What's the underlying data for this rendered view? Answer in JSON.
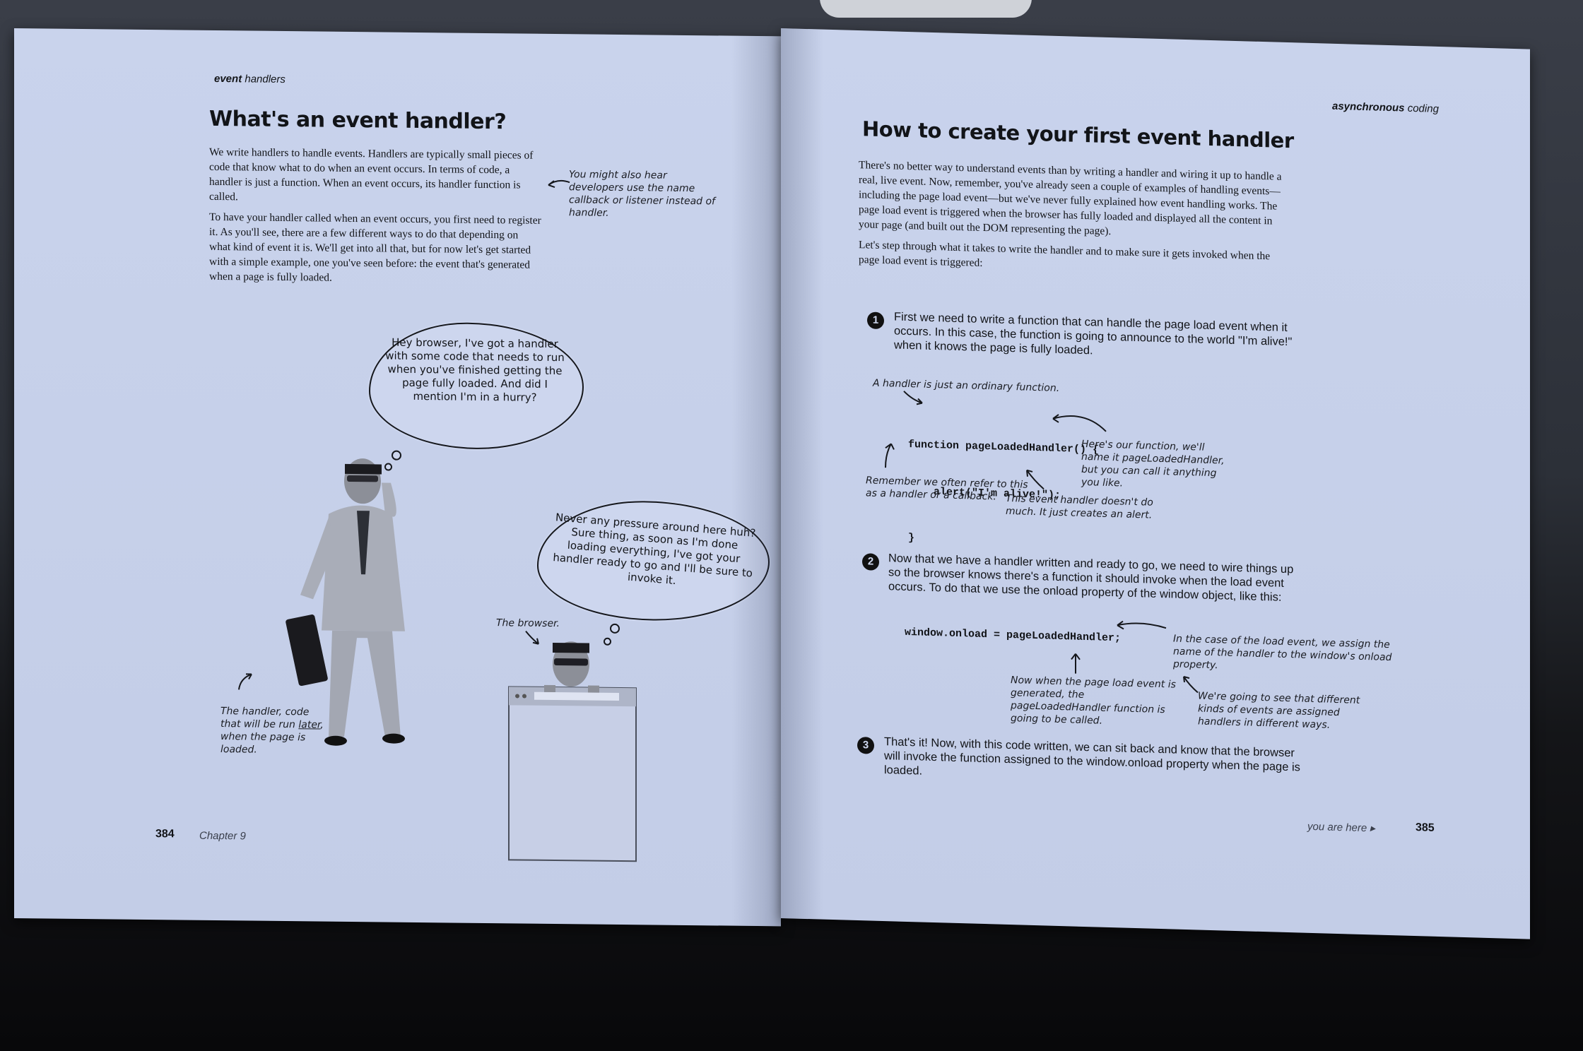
{
  "left_page": {
    "header": {
      "bold": "event",
      "light": "handlers"
    },
    "title": "What's an event handler?",
    "paragraphs": [
      "We write handlers to handle events. Handlers are typically small pieces of code that know what to do when an event occurs. In terms of code, a handler is just a function. When an event occurs, its handler function is called.",
      "To have your handler called when an event occurs, you first need to register it. As you'll see, there are a few different ways to do that depending on what kind of event it is. We'll get into all that, but for now let's get started with a simple example, one you've seen before: the event that's generated when a page is fully loaded."
    ],
    "side_note": "You might also hear developers use the name callback or listener instead of handler.",
    "cloud_1": "Hey browser, I've got a handler with some code that needs to run when you've finished getting the page fully loaded. And did I mention I'm in a hurry?",
    "cloud_2": "Never any pressure around here huh? Sure thing, as soon as I'm done loading everything, I've got your handler ready to go and I'll be sure to invoke it.",
    "browser_label": "The browser.",
    "handler_note": {
      "before": "The handler, code that will be run ",
      "underlined": "later",
      "after": ", when the page is loaded."
    },
    "page_number": "384",
    "chapter": "Chapter 9"
  },
  "right_page": {
    "header": {
      "bold": "asynchronous",
      "light": "coding"
    },
    "title": "How to create your first event handler",
    "paragraphs": [
      "There's no better way to understand events than by writing a handler and wiring it up to handle a real, live event. Now, remember, you've already seen a couple of examples of handling events—including the page load event—but we've never fully explained how event handling works. The page load event is triggered when the browser has fully loaded and displayed all the content in your page (and built out the DOM representing the page).",
      "Let's step through what it takes to write the handler and to make sure it gets invoked when the page load event is triggered:"
    ],
    "steps": [
      {
        "num": "1",
        "text": "First we need to write a function that can handle the page load event when it occurs. In this case, the function is going to announce to the world \"I'm alive!\" when it knows the page is fully loaded."
      },
      {
        "num": "2",
        "text": "Now that we have a handler written and ready to go, we need to wire things up so the browser knows there's a function it should invoke when the load event occurs. To do that we use the onload property of the window object, like this:"
      },
      {
        "num": "3",
        "text": "That's it! Now, with this code written, we can sit back and know that the browser will invoke the function assigned to the window.onload property when the page is loaded."
      }
    ],
    "code_1": [
      "function pageLoadedHandler() {",
      "    alert(\"I'm alive!\");",
      "}"
    ],
    "code_2": "window.onload = pageLoadedHandler;",
    "notes": {
      "ordinary": "A handler is just an ordinary function.",
      "name_it": "Here's our function, we'll name it pageLoadedHandler, but you can call it anything you like.",
      "refer": "Remember we often refer to this as a handler or a callback.",
      "alert": "This event handler doesn't do much. It just creates an alert.",
      "assign": "In the case of the load event, we assign the name of the handler to the window's onload property.",
      "called": "Now when the page load event is generated, the pageLoadedHandler function is going to be called.",
      "kinds": "We're going to see that different kinds of events are assigned handlers in different ways."
    },
    "footer_label": "you are here ▸",
    "page_number": "385"
  }
}
